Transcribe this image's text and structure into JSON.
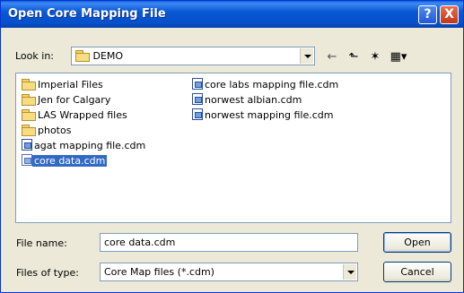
{
  "window": {
    "title": "Open Core Mapping File"
  },
  "title_buttons": {
    "help": "?",
    "close": "X"
  },
  "look_in": {
    "label": "Look in:",
    "value": "DEMO"
  },
  "toolbar": {
    "back_icon": "arrow-left-icon",
    "up_icon": "up-folder-icon",
    "new_folder_icon": "new-folder-icon",
    "view_icon": "view-menu-icon"
  },
  "files": {
    "col1": [
      {
        "name": "Imperial Files",
        "type": "folder"
      },
      {
        "name": "Jen for Calgary",
        "type": "folder"
      },
      {
        "name": "LAS Wrapped files",
        "type": "folder"
      },
      {
        "name": "photos",
        "type": "folder"
      },
      {
        "name": "agat mapping file.cdm",
        "type": "file"
      },
      {
        "name": "core data.cdm",
        "type": "file",
        "selected": true
      }
    ],
    "col2": [
      {
        "name": "core labs mapping file.cdm",
        "type": "file"
      },
      {
        "name": "norwest albian.cdm",
        "type": "file"
      },
      {
        "name": "norwest mapping file.cdm",
        "type": "file"
      }
    ]
  },
  "file_name": {
    "label": "File name:",
    "value": "core data.cdm"
  },
  "file_type": {
    "label": "Files of type:",
    "value": "Core Map files (*.cdm)"
  },
  "buttons": {
    "open": "Open",
    "cancel": "Cancel"
  },
  "colors": {
    "title_blue": "#0a58d6",
    "selection": "#316ac5",
    "dialog_bg": "#ece9d8"
  }
}
